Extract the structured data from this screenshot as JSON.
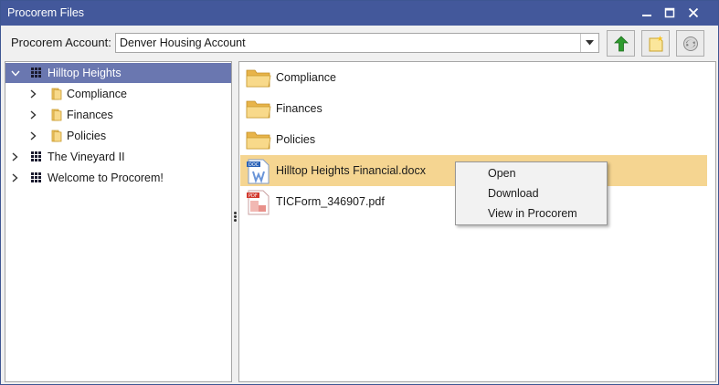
{
  "window": {
    "title": "Procorem Files"
  },
  "toolbar": {
    "account_label": "Procorem Account:",
    "account_value": "Denver Housing Account"
  },
  "tree": [
    {
      "label": "Hilltop Heights",
      "level": 0,
      "expanded": true,
      "selected": true,
      "icon": "grid-icon"
    },
    {
      "label": "Compliance",
      "level": 1,
      "expanded": false,
      "icon": "folder-icon"
    },
    {
      "label": "Finances",
      "level": 1,
      "expanded": false,
      "icon": "folder-icon"
    },
    {
      "label": "Policies",
      "level": 1,
      "expanded": false,
      "icon": "folder-icon"
    },
    {
      "label": "The Vineyard II",
      "level": 0,
      "expanded": false,
      "icon": "grid-icon"
    },
    {
      "label": "Welcome to Procorem!",
      "level": 0,
      "expanded": false,
      "icon": "grid-icon"
    }
  ],
  "files": [
    {
      "label": "Compliance",
      "type": "folder"
    },
    {
      "label": "Finances",
      "type": "folder"
    },
    {
      "label": "Policies",
      "type": "folder"
    },
    {
      "label": "Hilltop Heights Financial.docx",
      "type": "docx",
      "highlighted": true
    },
    {
      "label": "TICForm_346907.pdf",
      "type": "pdf"
    }
  ],
  "context_menu": {
    "items": [
      "Open",
      "Download",
      "View in Procorem"
    ]
  },
  "colors": {
    "titlebar": "#43589b",
    "tree_selection": "#6a77b0",
    "file_highlight": "#f5d591",
    "folder": "#f4c96a",
    "upload_arrow": "#2e9b2e"
  }
}
